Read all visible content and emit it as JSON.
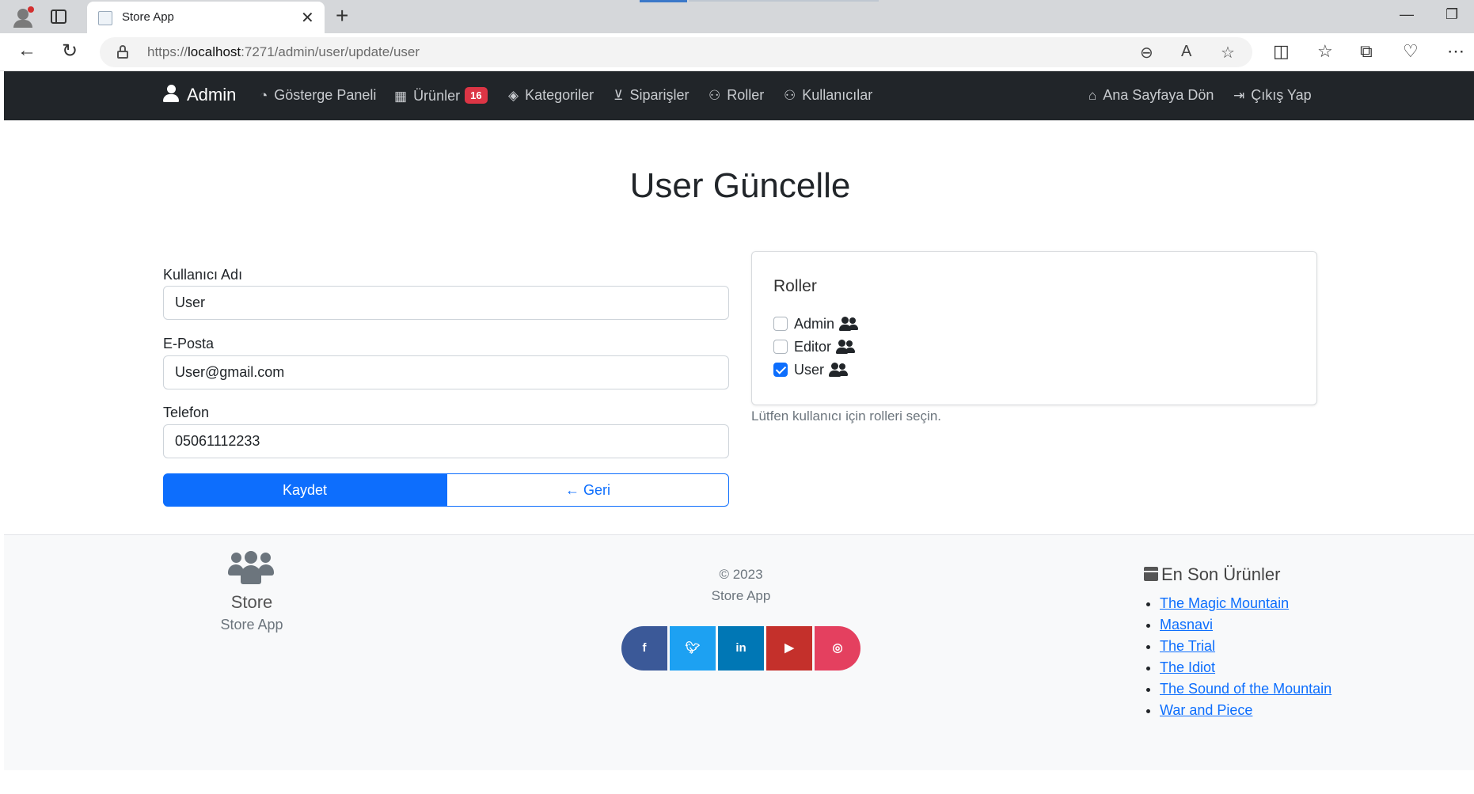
{
  "browser": {
    "tab_title": "Store App",
    "url_prefix": "https://",
    "url_host": "localhost",
    "url_rest": ":7271/admin/user/update/user"
  },
  "navbar": {
    "brand": "Admin",
    "links": {
      "dashboard": "Gösterge Paneli",
      "products": "Ürünler",
      "products_badge": "16",
      "categories": "Kategoriler",
      "orders": "Siparişler",
      "roles": "Roller",
      "users": "Kullanıcılar",
      "home": "Ana Sayfaya Dön",
      "logout": "Çıkış Yap"
    }
  },
  "page": {
    "title": "User Güncelle"
  },
  "form": {
    "username_label": "Kullanıcı Adı",
    "username_value": "User",
    "email_label": "E-Posta",
    "email_value": "User@gmail.com",
    "phone_label": "Telefon",
    "phone_value": "05061112233",
    "save_label": "Kaydet",
    "back_label": "Geri"
  },
  "roles": {
    "title": "Roller",
    "items": [
      {
        "label": "Admin",
        "checked": false
      },
      {
        "label": "Editor",
        "checked": false
      },
      {
        "label": "User",
        "checked": true
      }
    ],
    "help": "Lütfen kullanıcı için rolleri seçin."
  },
  "footer": {
    "store_title": "Store",
    "store_sub": "Store App",
    "copyright": "© 2023",
    "app_name": "Store App",
    "social": [
      {
        "name": "facebook",
        "color": "#3b5998"
      },
      {
        "name": "twitter",
        "color": "#1da1f2"
      },
      {
        "name": "linkedin",
        "color": "#0077b5"
      },
      {
        "name": "youtube",
        "color": "#c4302b"
      },
      {
        "name": "instagram",
        "color": "#e4405f"
      }
    ],
    "latest_title": "En Son Ürünler",
    "latest_products": [
      "The Magic Mountain",
      "Masnavi",
      "The Trial",
      "The Idiot",
      "The Sound of the Mountain",
      "War and Piece"
    ]
  },
  "colors": {
    "primary": "#0d6efd",
    "navbar_bg": "#212529",
    "badge": "#dc3545"
  }
}
